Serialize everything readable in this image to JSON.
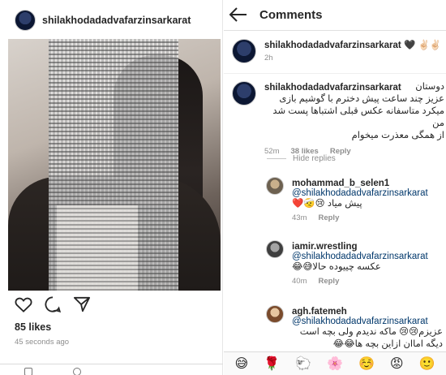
{
  "post": {
    "username": "shilakhodadadvafarzinsarkarat",
    "likes": "85 likes",
    "time_ago": "45 seconds ago"
  },
  "comments_screen": {
    "title": "Comments",
    "caption": {
      "username": "shilakhodadadvafarzinsarkarat",
      "emojis": "🖤 ✌🏻✌🏻",
      "time": "2h"
    },
    "main_comment": {
      "username": "shilakhodadadvafarzinsarkarat",
      "lead_word": "دوستان",
      "text_lines": [
        "عزیز چند ساعت پیش دخترم با گوشیم بازی",
        "میکرد متاسفانه عکس قبلی اشتباها پست شد من",
        "از همگی معذرت میخوام"
      ],
      "time": "52m",
      "likes": "38 likes",
      "reply_label": "Reply"
    },
    "hide_replies": "Hide replies",
    "replies": [
      {
        "username": "mohammad_b_selen1",
        "mention": "@shilakhodadadvafarzinsarkarat",
        "text": "پیش میاد 😢🤕❤️",
        "time": "43m",
        "reply_label": "Reply"
      },
      {
        "username": "iamir.wrestling",
        "mention": "@shilakhodadadvafarzinsarkarat",
        "text": "عکسه چییوده حالا😅😂",
        "time": "40m",
        "reply_label": "Reply"
      },
      {
        "username": "agh.fatemeh",
        "mention": "@shilakhodadadvafarzinsarkarat",
        "text_lines": [
          "عزیزم😢😢 ماکه ندیدم  ولی بچه است",
          "دیگه اماان ازاین بچه ها😂😂"
        ]
      }
    ],
    "emoji_bar": [
      "😅",
      "🌹",
      "🐑",
      "🌸",
      "☺️",
      "😡",
      "🙂"
    ]
  },
  "colors": {
    "mention": "#00376b",
    "meta_gray": "#8e8e8e",
    "text": "#262626"
  }
}
